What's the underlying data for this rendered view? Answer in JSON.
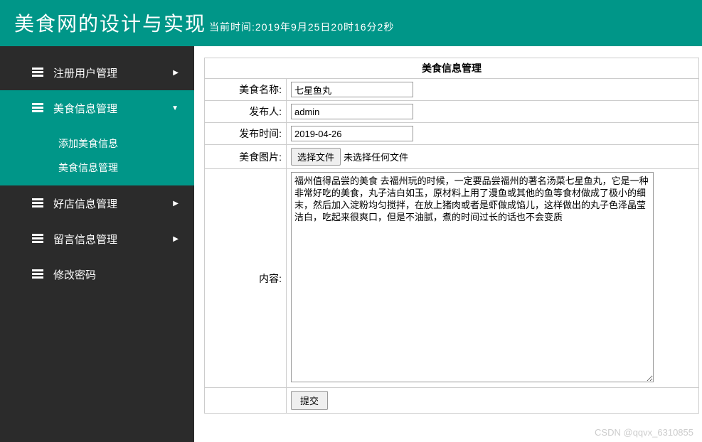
{
  "header": {
    "title": "美食网的设计与实现",
    "time": "当前时间:2019年9月25日20时16分2秒"
  },
  "sidebar": {
    "items": [
      {
        "label": "注册用户管理"
      },
      {
        "label": "美食信息管理"
      },
      {
        "label": "好店信息管理"
      },
      {
        "label": "留言信息管理"
      },
      {
        "label": "修改密码"
      }
    ],
    "submenu": [
      {
        "label": "添加美食信息"
      },
      {
        "label": "美食信息管理"
      }
    ]
  },
  "panel": {
    "title": "美食信息管理"
  },
  "form": {
    "labels": {
      "name": "美食名称:",
      "publisher": "发布人:",
      "time": "发布时间:",
      "image": "美食图片:",
      "content": "内容:"
    },
    "values": {
      "name": "七星鱼丸",
      "publisher": "admin",
      "time": "2019-04-26",
      "content": "福州值得品尝的美食 去福州玩的时候，一定要品尝福州的著名汤菜七星鱼丸，它是一种非常好吃的美食，丸子洁白如玉，原材料上用了漫鱼或其他的鱼等食材做成了极小的细末，然后加入淀粉均匀搅拌，在放上猪肉或者是虾做成馅儿，这样做出的丸子色泽晶莹洁白，吃起来很爽口，但是不油腻，煮的时间过长的话也不会变质"
    },
    "file": {
      "button": "选择文件",
      "status": "未选择任何文件"
    },
    "submit": "提交"
  },
  "watermark": "CSDN @qqvx_6310855"
}
